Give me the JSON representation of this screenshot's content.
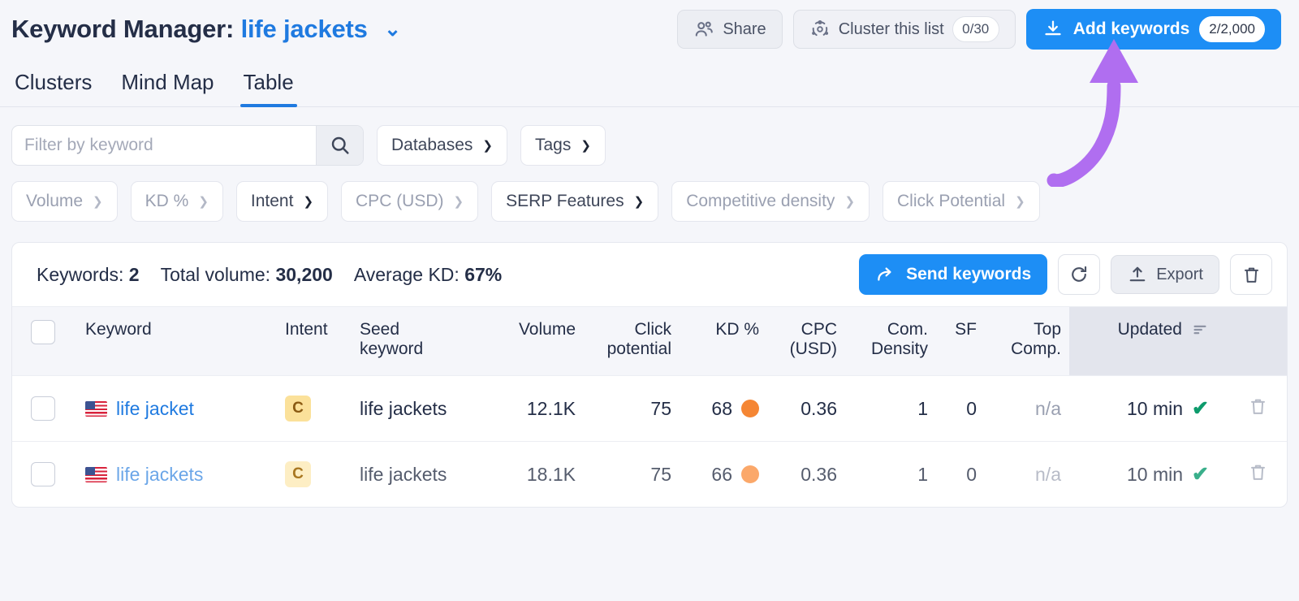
{
  "header": {
    "title_prefix": "Keyword Manager:",
    "title_value": "life jackets",
    "caret": "⌄",
    "share_label": "Share",
    "cluster_label": "Cluster this list",
    "cluster_count": "0/30",
    "add_keywords_label": "Add keywords",
    "add_keywords_count": "2/2,000"
  },
  "tabs": [
    {
      "label": "Clusters",
      "active": false
    },
    {
      "label": "Mind Map",
      "active": false
    },
    {
      "label": "Table",
      "active": true
    }
  ],
  "filters": {
    "search_placeholder": "Filter by keyword",
    "search_value": "",
    "row1": [
      {
        "label": "Databases",
        "strong": true
      },
      {
        "label": "Tags",
        "strong": true
      }
    ],
    "row2": [
      {
        "label": "Volume",
        "strong": false
      },
      {
        "label": "KD %",
        "strong": false
      },
      {
        "label": "Intent",
        "strong": true
      },
      {
        "label": "CPC (USD)",
        "strong": false
      },
      {
        "label": "SERP Features",
        "strong": true
      },
      {
        "label": "Competitive density",
        "strong": false
      },
      {
        "label": "Click Potential",
        "strong": false
      }
    ]
  },
  "stats": {
    "keywords_label": "Keywords:",
    "keywords_value": "2",
    "volume_label": "Total volume:",
    "volume_value": "30,200",
    "kd_label": "Average KD:",
    "kd_value": "67%"
  },
  "card_actions": {
    "send_label": "Send keywords",
    "export_label": "Export"
  },
  "table": {
    "columns": [
      "Keyword",
      "Intent",
      "Seed keyword",
      "Volume",
      "Click potential",
      "KD %",
      "CPC (USD)",
      "Com. Density",
      "SF",
      "Top Comp.",
      "Updated"
    ],
    "headers": {
      "keyword": "Keyword",
      "intent": "Intent",
      "seed_line1": "Seed",
      "seed_line2": "keyword",
      "volume": "Volume",
      "click_line1": "Click",
      "click_line2": "potential",
      "kd": "KD %",
      "cpc_line1": "CPC",
      "cpc_line2": "(USD)",
      "comd_line1": "Com.",
      "comd_line2": "Density",
      "sf": "SF",
      "topc_line1": "Top",
      "topc_line2": "Comp.",
      "updated": "Updated"
    },
    "rows": [
      {
        "keyword": "life jacket",
        "flag": "us-flag",
        "intent": "C",
        "seed_keyword": "life jackets",
        "volume": "12.1K",
        "click_potential": "75",
        "kd": "68",
        "cpc": "0.36",
        "com_density": "1",
        "sf": "0",
        "top_comp": "n/a",
        "updated": "10 min"
      },
      {
        "keyword": "life jackets",
        "flag": "us-flag",
        "intent": "C",
        "seed_keyword": "life jackets",
        "volume": "18.1K",
        "click_potential": "75",
        "kd": "66",
        "cpc": "0.36",
        "com_density": "1",
        "sf": "0",
        "top_comp": "n/a",
        "updated": "10 min"
      }
    ]
  },
  "annotation": {
    "arrow_color": "#b06ef0",
    "points_to": "Add keywords"
  },
  "colors": {
    "accent_blue": "#1d8ef5",
    "link_blue": "#1f7ae0",
    "intent_badge": "#fbe19a",
    "kd_orange": "#f58634",
    "check_green": "#0d9b6c",
    "arrow_purple": "#b06ef0"
  }
}
